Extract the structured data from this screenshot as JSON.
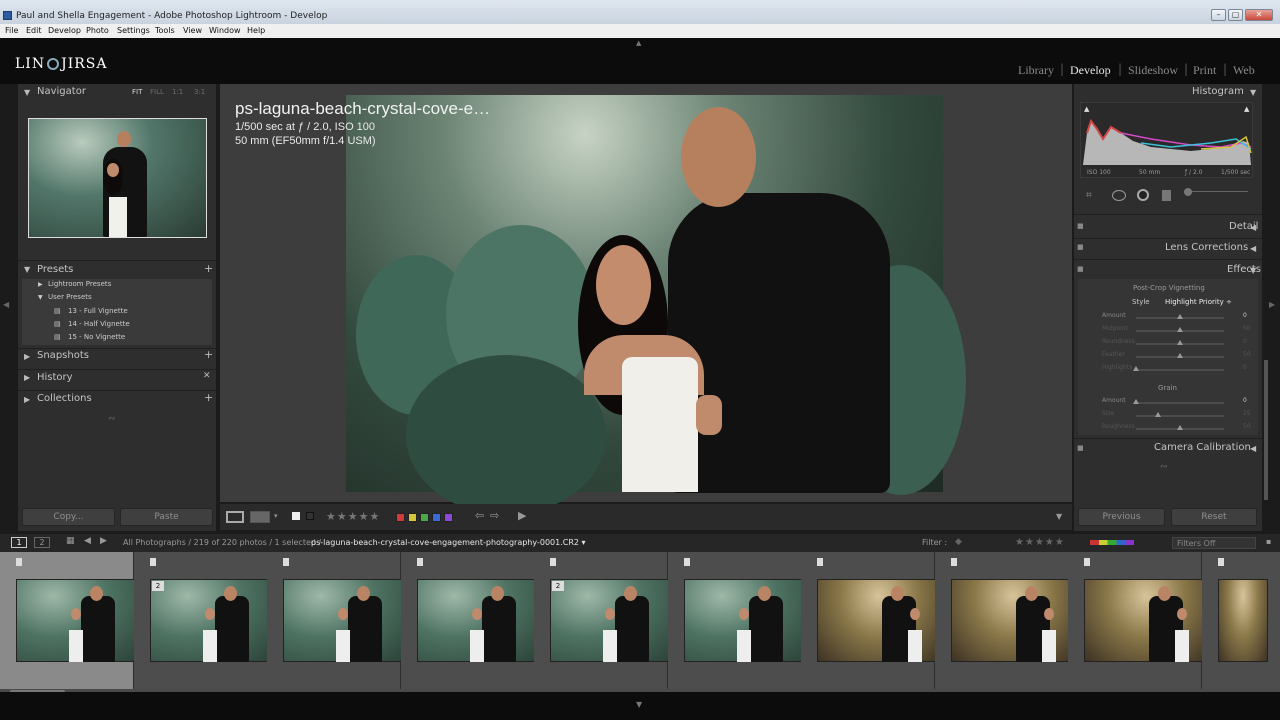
{
  "window": {
    "title": "Paul and Shella Engagement - Adobe Photoshop Lightroom - Develop",
    "controls": {
      "minimize": "–",
      "maximize": "▢",
      "close": "✕"
    }
  },
  "menu": [
    "File",
    "Edit",
    "Develop",
    "Photo",
    "Settings",
    "Tools",
    "View",
    "Window",
    "Help"
  ],
  "logo": {
    "left": "LIN",
    "right": "JIRSA"
  },
  "modules": {
    "items": [
      "Library",
      "Develop",
      "Slideshow",
      "Print",
      "Web"
    ],
    "active": "Develop"
  },
  "navigator": {
    "title": "Navigator",
    "zoom": [
      "FIT",
      "FILL",
      "1:1",
      "3:1"
    ]
  },
  "presets": {
    "title": "Presets",
    "folders": [
      "Lightroom Presets",
      "User Presets"
    ],
    "items": [
      "13 - Full Vignette",
      "14 - Half Vignette",
      "15 - No Vignette"
    ]
  },
  "left_sections": {
    "snapshots": "Snapshots",
    "history": "History",
    "collections": "Collections"
  },
  "left_buttons": {
    "copy": "Copy...",
    "paste": "Paste"
  },
  "image_info": {
    "filename": "ps-laguna-beach-crystal-cove-e…",
    "exposure": "1/500 sec at ƒ / 2.0, ISO 100",
    "lens": "50 mm (EF50mm f/1.4 USM)"
  },
  "histogram": {
    "title": "Histogram",
    "iso": "ISO 100",
    "focal": "50 mm",
    "aperture": "ƒ / 2.0",
    "shutter": "1/500 sec"
  },
  "right_sections": {
    "detail": "Detail",
    "lens": "Lens Corrections",
    "effects": "Effects",
    "calibration": "Camera Calibration"
  },
  "effects": {
    "vignetting_title": "Post-Crop Vignetting",
    "style_label": "Style",
    "style_value": "Highlight Priority ÷",
    "sliders": [
      {
        "label": "Amount",
        "value": "0",
        "level": 0.5
      },
      {
        "label": "Midpoint",
        "value": "50",
        "level": 0.5
      },
      {
        "label": "Roundness",
        "value": "0",
        "level": 0.5
      },
      {
        "label": "Feather",
        "value": "50",
        "level": 0.5
      },
      {
        "label": "Highlights",
        "value": "0",
        "level": 0.0
      }
    ],
    "grain_title": "Grain",
    "grain_sliders": [
      {
        "label": "Amount",
        "value": "0",
        "level": 0.0
      },
      {
        "label": "Size",
        "value": "25",
        "level": 0.25
      },
      {
        "label": "Roughness",
        "value": "50",
        "level": 0.5
      }
    ]
  },
  "right_buttons": {
    "previous": "Previous",
    "reset": "Reset"
  },
  "toolbar": {
    "stars": "★★★★★"
  },
  "color_labels": [
    "#d23a3a",
    "#d8c63a",
    "#4aa84a",
    "#3a6ad8",
    "#8a4ad8"
  ],
  "filmbar": {
    "monitors": [
      "1",
      "2"
    ],
    "source": "All Photographs / 219 of 220 photos / 1 selected /",
    "filename": "ps-laguna-beach-crystal-cove-engagement-photography-0001.CR2 ▾",
    "filter_label": "Filter :",
    "filter_value": "Filters Off",
    "stars": "★★★★★"
  },
  "filmstrip": {
    "thumbs": [
      {
        "tone": "green",
        "badge": ""
      },
      {
        "tone": "green",
        "badge": "2"
      },
      {
        "tone": "green",
        "badge": ""
      },
      {
        "tone": "green",
        "badge": ""
      },
      {
        "tone": "green",
        "badge": "2"
      },
      {
        "tone": "green",
        "badge": ""
      },
      {
        "tone": "warm",
        "badge": ""
      },
      {
        "tone": "warm",
        "badge": ""
      },
      {
        "tone": "warm",
        "badge": ""
      },
      {
        "tone": "warm",
        "badge": ""
      }
    ]
  }
}
